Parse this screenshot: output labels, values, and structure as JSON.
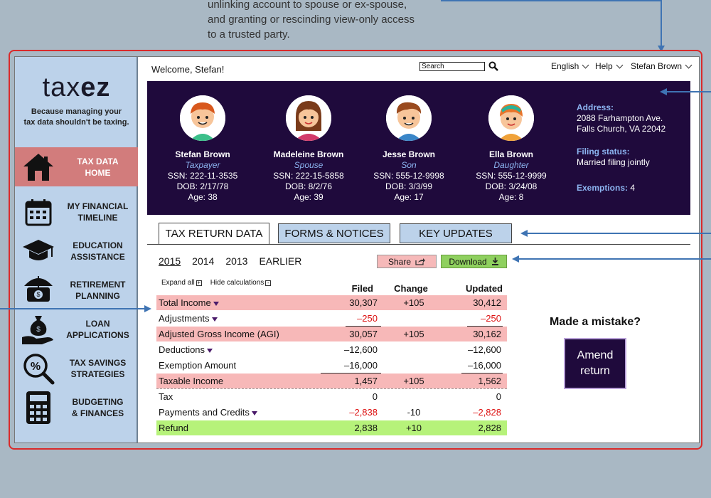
{
  "annotation": {
    "line1": "unlinking account to spouse or ex-spouse,",
    "line2": "and granting or rescinding view-only access",
    "line3": "to a trusted party."
  },
  "brand": {
    "logo_part1": "tax",
    "logo_part2": "ez",
    "tagline_line1": "Because managing your",
    "tagline_line2": "tax data shouldn't be taxing."
  },
  "sidebar": {
    "items": [
      {
        "line1": "TAX DATA",
        "line2": "HOME",
        "icon": "house-icon"
      },
      {
        "line1": "MY FINANCIAL",
        "line2": "TIMELINE",
        "icon": "calendar-icon"
      },
      {
        "line1": "EDUCATION",
        "line2": "ASSISTANCE",
        "icon": "graduation-cap-icon"
      },
      {
        "line1": "RETIREMENT",
        "line2": "PLANNING",
        "icon": "umbrella-money-icon"
      },
      {
        "line1": "LOAN",
        "line2": "APPLICATIONS",
        "icon": "money-bag-hand-icon"
      },
      {
        "line1": "TAX SAVINGS",
        "line2": "STRATEGIES",
        "icon": "percent-magnifier-icon"
      },
      {
        "line1": "BUDGETING",
        "line2": "& FINANCES",
        "icon": "calculator-icon"
      }
    ]
  },
  "header": {
    "welcome": "Welcome, Stefan!",
    "search_label": "Search",
    "language": "English",
    "help": "Help",
    "user": "Stefan Brown"
  },
  "family": {
    "members": [
      {
        "name": "Stefan Brown",
        "role": "Taxpayer",
        "ssn": "SSN: 222-11-3535",
        "dob": "DOB: 2/17/78",
        "age": "Age: 38"
      },
      {
        "name": "Madeleine Brown",
        "role": "Spouse",
        "ssn": "SSN: 222-15-5858",
        "dob": "DOB: 8/2/76",
        "age": "Age: 39"
      },
      {
        "name": "Jesse Brown",
        "role": "Son",
        "ssn": "SSN: 555-12-9998",
        "dob": "DOB: 3/3/99",
        "age": "Age: 17"
      },
      {
        "name": "Ella Brown",
        "role": "Daughter",
        "ssn": "SSN: 555-12-9999",
        "dob": "DOB: 3/24/08",
        "age": "Age: 8"
      }
    ],
    "address_label": "Address:",
    "address_line1": "2088 Farhampton Ave.",
    "address_line2": "Falls Church, VA 22042",
    "filing_label": "Filing status:",
    "filing_value": "Married filing jointly",
    "exemptions_label": "Exemptions:",
    "exemptions_value": "4"
  },
  "tabs": {
    "tax_return": "TAX RETURN DATA",
    "forms": "FORMS & NOTICES",
    "updates": "KEY UPDATES"
  },
  "years": {
    "y1": "2015",
    "y2": "2014",
    "y3": "2013",
    "earlier": "EARLIER"
  },
  "actions": {
    "share": "Share",
    "download": "Download",
    "expand_all": "Expand all",
    "hide_calc": "Hide calculations"
  },
  "table": {
    "headers": {
      "filed": "Filed",
      "change": "Change",
      "updated": "Updated"
    },
    "rows": [
      {
        "label": "Total Income",
        "filed": "30,307",
        "change": "+105",
        "updated": "30,412"
      },
      {
        "label": "Adjustments",
        "filed": "–250",
        "change": "",
        "updated": "–250"
      },
      {
        "label": "Adjusted Gross Income (AGI)",
        "filed": "30,057",
        "change": "+105",
        "updated": "30,162"
      },
      {
        "label": "Deductions",
        "filed": "–12,600",
        "change": "",
        "updated": "–12,600"
      },
      {
        "label": "Exemption Amount",
        "filed": "–16,000",
        "change": "",
        "updated": "–16,000"
      },
      {
        "label": "Taxable Income",
        "filed": "1,457",
        "change": "+105",
        "updated": "1,562"
      },
      {
        "label": "Tax",
        "filed": "0",
        "change": "",
        "updated": "0"
      },
      {
        "label": "Payments and Credits",
        "filed": "–2,838",
        "change": "-10",
        "updated": "–2,828"
      },
      {
        "label": "Refund",
        "filed": "2,838",
        "change": "+10",
        "updated": "2,828"
      }
    ]
  },
  "amend": {
    "question": "Made a mistake?",
    "line1": "Amend",
    "line2": "return"
  },
  "colors": {
    "accent_dark": "#1f0a3c",
    "sidebar_bg": "#bcd2ea",
    "active_nav": "#d27c7c",
    "row_pink": "#f7b8b8",
    "row_green": "#b6f27a",
    "frame_red": "#d92a2a",
    "arrow_blue": "#3f74b3"
  }
}
